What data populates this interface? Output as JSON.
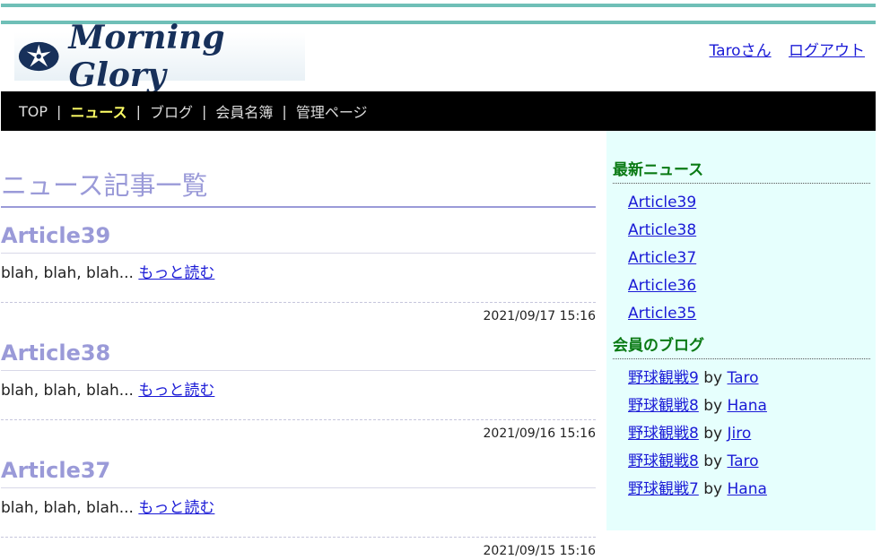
{
  "logo": {
    "text": "Morning Glory",
    "brand_color": "#17305a"
  },
  "user": {
    "name_link": "Taroさん",
    "logout_link": "ログアウト"
  },
  "nav": {
    "items": [
      "TOP",
      "ニュース",
      "ブログ",
      "会員名簿",
      "管理ページ"
    ],
    "active": "ニュース",
    "separator": "|"
  },
  "main": {
    "title": "ニュース記事一覧",
    "articles": [
      {
        "title": "Article39",
        "excerpt": "blah, blah, blah...",
        "read_more": "もっと読む",
        "date": "2021/09/17 15:16"
      },
      {
        "title": "Article38",
        "excerpt": "blah, blah, blah...",
        "read_more": "もっと読む",
        "date": "2021/09/16 15:16"
      },
      {
        "title": "Article37",
        "excerpt": "blah, blah, blah...",
        "read_more": "もっと読む",
        "date": "2021/09/15 15:16"
      }
    ]
  },
  "sidebar": {
    "news_heading": "最新ニュース",
    "news": [
      "Article39",
      "Article38",
      "Article37",
      "Article36",
      "Article35"
    ],
    "blog_heading": "会員のブログ",
    "by": "by",
    "blogs": [
      {
        "title": "野球観戦9",
        "author": "Taro"
      },
      {
        "title": "野球観戦8",
        "author": "Hana"
      },
      {
        "title": "野球観戦8",
        "author": "Jiro"
      },
      {
        "title": "野球観戦8",
        "author": "Taro"
      },
      {
        "title": "野球観戦7",
        "author": "Hana"
      }
    ]
  },
  "colors": {
    "accent_line": "#6fbfb7",
    "title": "#9a9ad8",
    "sidebar_bg": "#e6fffd",
    "sidebar_heading": "#0a7a14",
    "link": "#1a1ad6"
  }
}
